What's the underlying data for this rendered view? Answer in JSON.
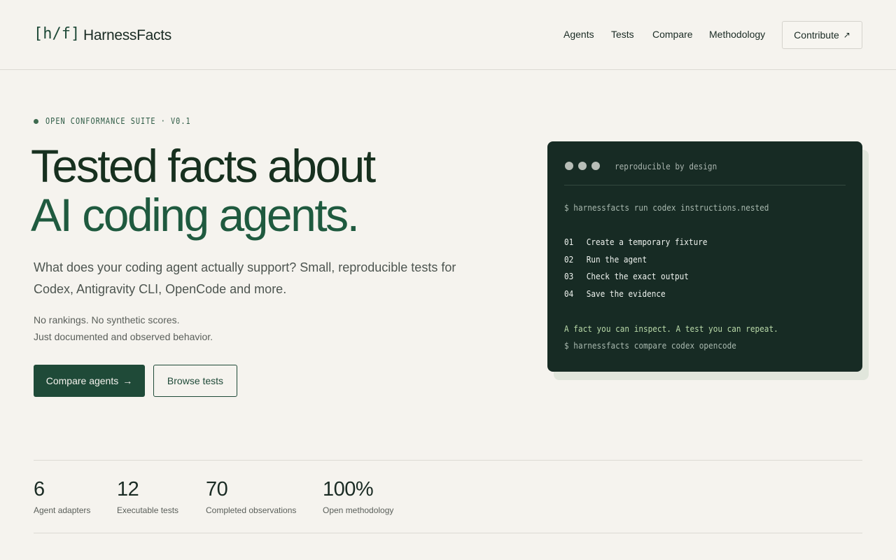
{
  "header": {
    "logo_mark": "[h/f]",
    "logo_text": "HarnessFacts",
    "nav": [
      "Agents",
      "Tests",
      "Compare",
      "Methodology"
    ],
    "contribute_label": "Contribute",
    "contribute_icon": "↗"
  },
  "hero": {
    "eyebrow": "OPEN CONFORMANCE SUITE · V0.1",
    "title_line1": "Tested facts about",
    "title_line2": "AI coding agents.",
    "lead": "What does your coding agent actually support? Small, reproducible tests for Codex, Antigravity CLI, OpenCode and more.",
    "sub_line1": "No rankings. No synthetic scores.",
    "sub_line2": "Just documented and observed behavior.",
    "primary_button": "Compare agents",
    "primary_button_icon": "→",
    "secondary_button": "Browse tests"
  },
  "terminal": {
    "caption": "reproducible by design",
    "command1": "$ harnessfacts run codex instructions.nested",
    "steps": [
      {
        "num": "01",
        "text": "Create a temporary fixture"
      },
      {
        "num": "02",
        "text": "Run the agent"
      },
      {
        "num": "03",
        "text": "Check the exact output"
      },
      {
        "num": "04",
        "text": "Save the evidence"
      }
    ],
    "fact": "A fact you can inspect. A test you can repeat.",
    "command2": "$ harnessfacts compare codex opencode"
  },
  "stats": [
    {
      "value": "6",
      "label": "Agent adapters"
    },
    {
      "value": "12",
      "label": "Executable tests"
    },
    {
      "value": "70",
      "label": "Completed observations"
    },
    {
      "value": "100%",
      "label": "Open methodology"
    }
  ],
  "colors": {
    "background": "#f5f3ee",
    "accent": "#1f4a38",
    "terminal_bg": "#172b24"
  }
}
